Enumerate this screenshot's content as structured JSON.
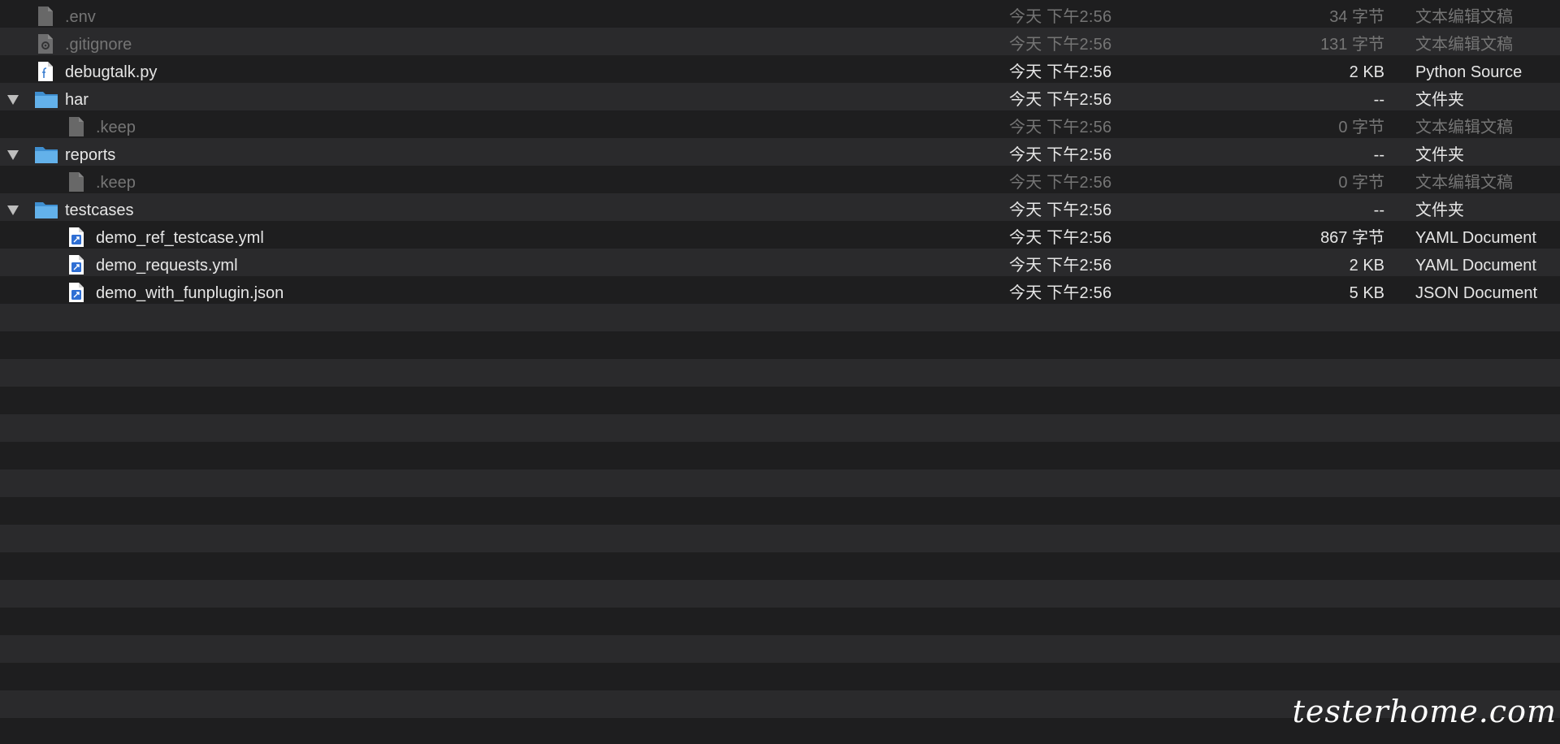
{
  "rows": [
    {
      "name": ".env",
      "date": "今天 下午2:56",
      "size": "34 字节",
      "kind": "文本编辑文稿",
      "icon": "document-icon",
      "hidden": true
    },
    {
      "name": ".gitignore",
      "date": "今天 下午2:56",
      "size": "131 字节",
      "kind": "文本编辑文稿",
      "icon": "gear-document-icon",
      "hidden": true
    },
    {
      "name": "debugtalk.py",
      "date": "今天 下午2:56",
      "size": "2 KB",
      "kind": "Python Source",
      "icon": "python-file-icon",
      "hidden": false
    },
    {
      "name": "har",
      "date": "今天 下午2:56",
      "size": "--",
      "kind": "文件夹",
      "icon": "folder-icon",
      "hidden": false,
      "expanded": true
    },
    {
      "name": ".keep",
      "date": "今天 下午2:56",
      "size": "0 字节",
      "kind": "文本编辑文稿",
      "icon": "document-icon",
      "hidden": true
    },
    {
      "name": "reports",
      "date": "今天 下午2:56",
      "size": "--",
      "kind": "文件夹",
      "icon": "folder-icon",
      "hidden": false,
      "expanded": true
    },
    {
      "name": ".keep",
      "date": "今天 下午2:56",
      "size": "0 字节",
      "kind": "文本编辑文稿",
      "icon": "document-icon",
      "hidden": true
    },
    {
      "name": "testcases",
      "date": "今天 下午2:56",
      "size": "--",
      "kind": "文件夹",
      "icon": "folder-icon",
      "hidden": false,
      "expanded": true
    },
    {
      "name": "demo_ref_testcase.yml",
      "date": "今天 下午2:56",
      "size": "867 字节",
      "kind": "YAML Document",
      "icon": "yaml-file-icon",
      "hidden": false
    },
    {
      "name": "demo_requests.yml",
      "date": "今天 下午2:56",
      "size": "2 KB",
      "kind": "YAML Document",
      "icon": "yaml-file-icon",
      "hidden": false
    },
    {
      "name": "demo_with_funplugin.json",
      "date": "今天 下午2:56",
      "size": "5 KB",
      "kind": "JSON Document",
      "icon": "json-file-icon",
      "hidden": false
    }
  ],
  "watermark": "testerhome.com",
  "colors": {
    "row_dark": "#1e1e1f",
    "row_light": "#2a2a2c",
    "text": "#e6e6e6",
    "hidden_text": "#757575",
    "folder": "#4aa0de"
  }
}
